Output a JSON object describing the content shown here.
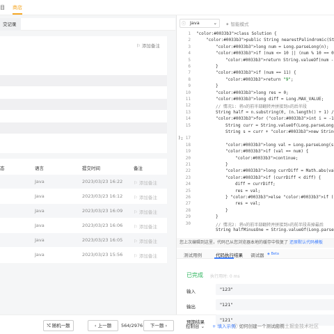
{
  "topbar": {
    "item1": "目",
    "item2": "商店"
  },
  "left": {
    "subtab_active": "交记录",
    "note_btn": "添加备注",
    "table_headers": [
      "态",
      "语言",
      "提交时间",
      "备注"
    ],
    "rows": [
      {
        "lang": "Java",
        "time": "2023/03/23 16:22",
        "note": "添加备注"
      },
      {
        "lang": "Java",
        "time": "2023/03/23 16:12",
        "note": "添加备注"
      },
      {
        "lang": "Java",
        "time": "2023/03/23 16:09",
        "note": "添加备注"
      },
      {
        "lang": "Java",
        "time": "2023/03/23 16:06",
        "note": "添加备注"
      },
      {
        "lang": "Java",
        "time": "2023/03/23 16:05",
        "note": "添加备注"
      },
      {
        "lang": "Java",
        "time": "2023/03/23 15:56",
        "note": "添加备注"
      }
    ]
  },
  "bottom": {
    "random": "随机一题",
    "prev": "上一题",
    "pager": "564/2976",
    "next": "下一题"
  },
  "editor": {
    "language": "Java",
    "smart_mode": "智能模式",
    "line_numbers": [
      "1",
      "2",
      "3",
      "4",
      "5",
      "6",
      "7",
      "8",
      "9",
      "10",
      "11",
      "12",
      "13",
      "14",
      "15",
      "",
      "17",
      "18",
      "19",
      "20",
      "21",
      "22",
      "23",
      "24",
      "25",
      "26",
      "27",
      "28",
      "29",
      "30"
    ],
    "lines": [
      {
        "indent": 0,
        "text": "class Solution {"
      },
      {
        "indent": 1,
        "text": "public String nearestPalindromic(String n) {"
      },
      {
        "indent": 2,
        "text": "long num = Long.parseLong(n);"
      },
      {
        "indent": 2,
        "text": "if (num <= 10 || (num % 10 == 0 && n.charAt(0) =="
      },
      {
        "indent": 3,
        "text": "return String.valueOf(num - 1);"
      },
      {
        "indent": 2,
        "text": "}"
      },
      {
        "indent": 2,
        "text": "if (num == 11) {"
      },
      {
        "indent": 3,
        "text": "return \"9\";"
      },
      {
        "indent": 2,
        "text": "}"
      },
      {
        "indent": 2,
        "text": "long res = 0;"
      },
      {
        "indent": 2,
        "text": "long diff = Long.MAX_VALUE;"
      },
      {
        "indent": 2,
        "text": "// 情况1: 将n的前半部翻转并拼接到n的后半段",
        "comment": true
      },
      {
        "indent": 2,
        "text": "String half = n.substring(0, (n.length() + 1) / 2"
      },
      {
        "indent": 2,
        "text": "for (int i = -1; i <= 1; i++) {"
      },
      {
        "indent": 3,
        "text": "String curr = String.valueOf(Long.parseLong(h"
      },
      {
        "indent": 3,
        "text": "String s = curr + new StringBuilder(curr.subs"
      },
      {
        "indent": -1,
        "text": ");"
      },
      {
        "indent": 3,
        "text": "long val = Long.parseLong(s);"
      },
      {
        "indent": 3,
        "text": "if (val == num) {"
      },
      {
        "indent": 4,
        "text": "continue;"
      },
      {
        "indent": 3,
        "text": "}"
      },
      {
        "indent": 3,
        "text": "long currDiff = Math.abs(val - num);"
      },
      {
        "indent": 3,
        "text": "if (currDiff < diff) {"
      },
      {
        "indent": 4,
        "text": "diff = currDiff;"
      },
      {
        "indent": 4,
        "text": "res = val;"
      },
      {
        "indent": 3,
        "text": "} else if (currDiff == diff && val < res) {"
      },
      {
        "indent": 4,
        "text": "res = val;"
      },
      {
        "indent": 3,
        "text": "}"
      },
      {
        "indent": 2,
        "text": "}"
      },
      {
        "indent": 2,
        "text": "// 情况2: 将n的前半部翻转并拼接到n的前半段去掉最后",
        "comment": true
      },
      {
        "indent": 2,
        "text": "String halfMinusOne = String.valueOf(Long.parseLo"
      }
    ]
  },
  "notice": {
    "text": "您上次编辑到这里，代码已从您浏览器本地的缓存中恢复了",
    "link": "还原默认代码模板"
  },
  "result_tabs": {
    "tab1": "测试用例",
    "tab2": "代码执行结果",
    "tab3": "调试器",
    "beta": "Beta"
  },
  "result": {
    "status": "已完成",
    "exec_time": "执行用时: 0 ms",
    "input_label": "输入",
    "input_value": "\"123\"",
    "output_label": "输出",
    "output_value": "\"121\"",
    "expected_label": "预期结果",
    "expected_value": "\"121\""
  },
  "console": {
    "label": "控制台",
    "example": "填入示例",
    "help": "如何创建一个测试用例"
  },
  "watermark": "@稀土掘金技术社区",
  "colors": {
    "accent": "#f5a623",
    "link": "#3b7cff",
    "success": "#2db55d",
    "keyword": "#0033b3",
    "comment": "#8a8a8a"
  }
}
